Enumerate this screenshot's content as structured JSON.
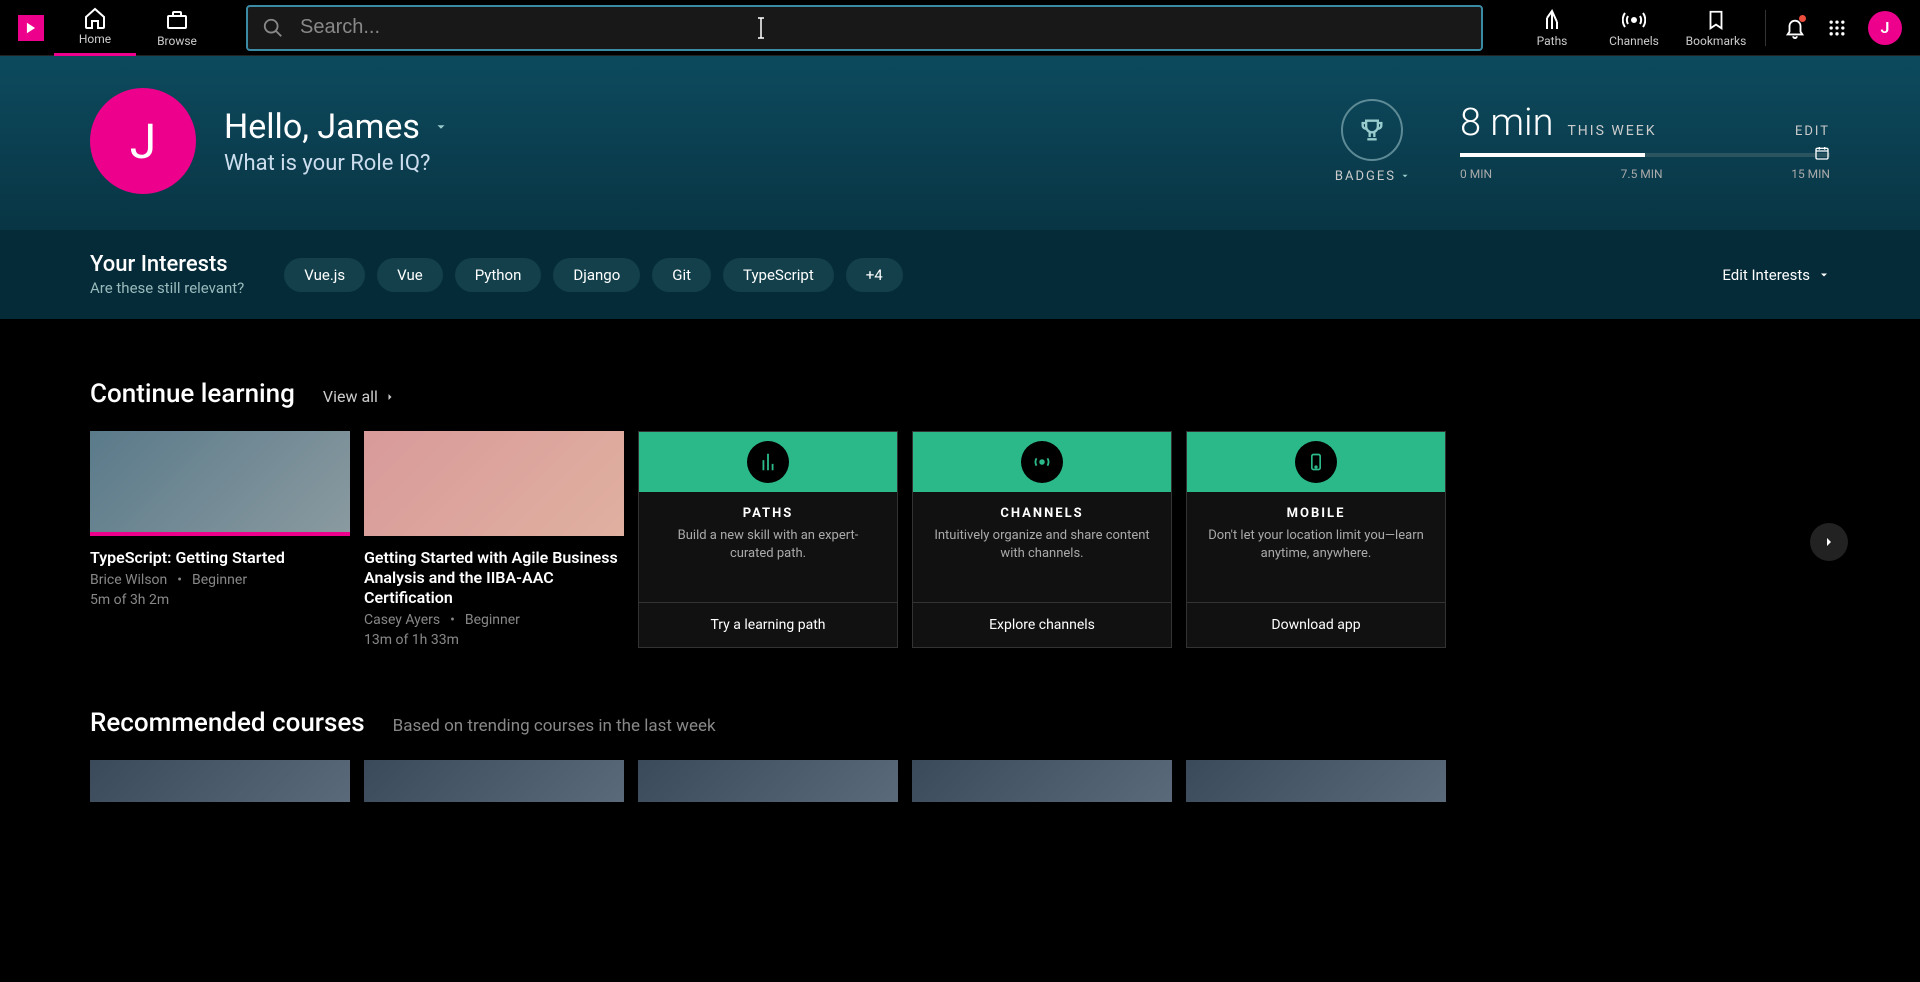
{
  "header": {
    "nav": [
      {
        "label": "Home",
        "name": "nav-home"
      },
      {
        "label": "Browse",
        "name": "nav-browse"
      }
    ],
    "search_placeholder": "Search...",
    "right_nav": [
      {
        "label": "Paths",
        "name": "nav-paths"
      },
      {
        "label": "Channels",
        "name": "nav-channels"
      },
      {
        "label": "Bookmarks",
        "name": "nav-bookmarks"
      }
    ],
    "avatar_initial": "J"
  },
  "hero": {
    "avatar_initial": "J",
    "greeting": "Hello, James",
    "sub": "What is your Role IQ?",
    "badges_label": "BADGES",
    "goal": {
      "time": "8 min",
      "period": "THIS WEEK",
      "edit": "EDIT",
      "marks": [
        "0 MIN",
        "7.5 MIN",
        "15 MIN"
      ],
      "progress_pct": 50
    }
  },
  "interests": {
    "title": "Your Interests",
    "sub": "Are these still relevant?",
    "pills": [
      "Vue.js",
      "Vue",
      "Python",
      "Django",
      "Git",
      "TypeScript",
      "+4"
    ],
    "edit": "Edit Interests"
  },
  "continue": {
    "title": "Continue learning",
    "view_all": "View all",
    "cards": [
      {
        "title": "TypeScript: Getting Started",
        "author": "Brice Wilson",
        "level": "Beginner",
        "time": "5m of 3h 2m"
      },
      {
        "title": "Getting Started with Agile Business Analysis and the IIBA-AAC Certification",
        "author": "Casey Ayers",
        "level": "Beginner",
        "time": "13m of 1h 33m"
      }
    ],
    "promos": [
      {
        "t": "PATHS",
        "d": "Build a new skill with an expert-curated path.",
        "btn": "Try a learning path"
      },
      {
        "t": "CHANNELS",
        "d": "Intuitively organize and share content with channels.",
        "btn": "Explore channels"
      },
      {
        "t": "MOBILE",
        "d": "Don't let your location limit you—learn anytime, anywhere.",
        "btn": "Download app"
      }
    ]
  },
  "recommended": {
    "title": "Recommended courses",
    "sub": "Based on trending courses in the last week"
  }
}
